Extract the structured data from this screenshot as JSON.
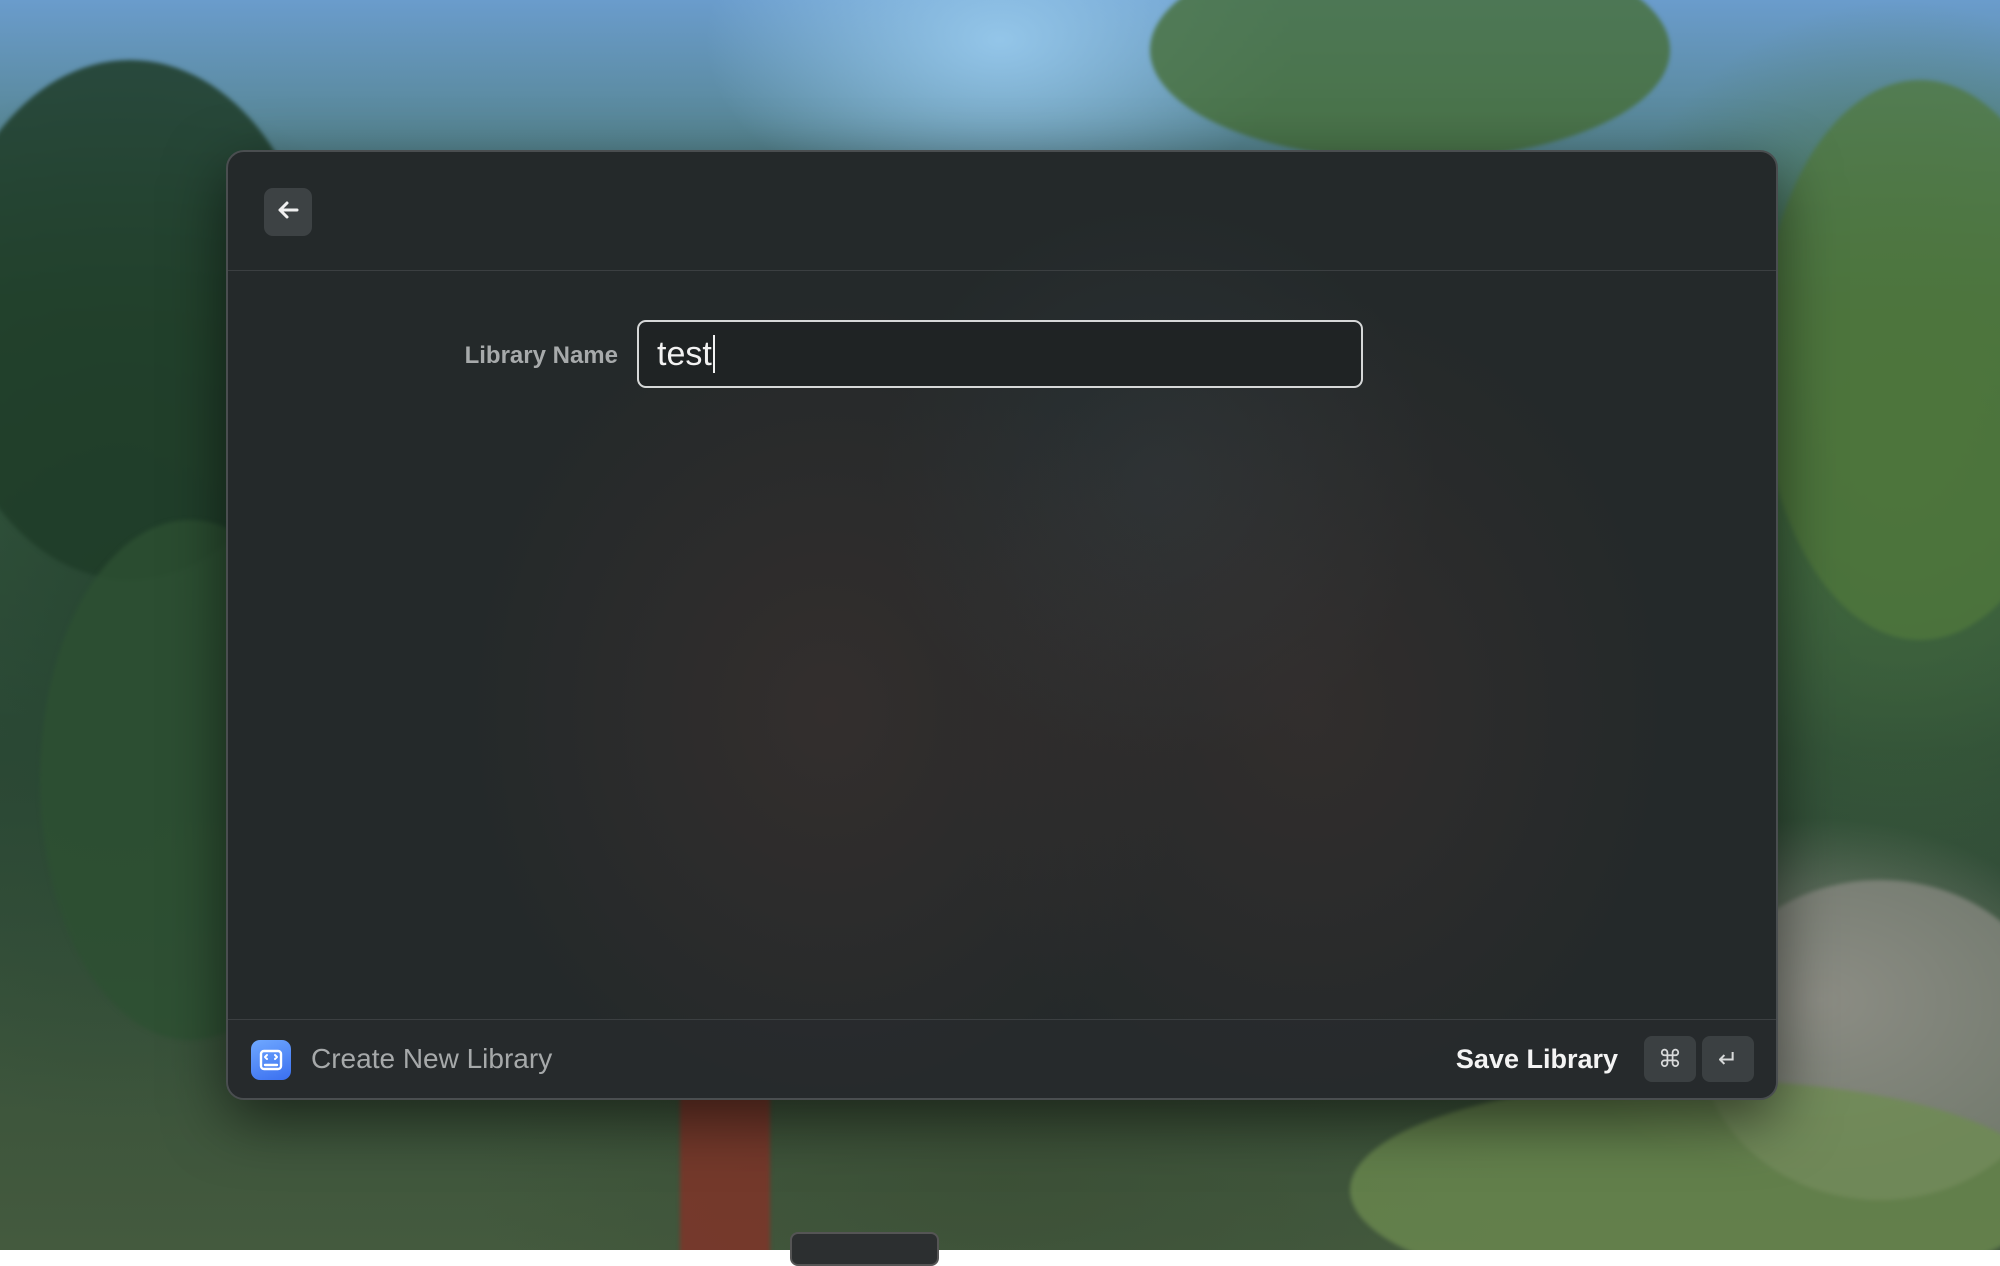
{
  "header": {
    "back_icon": "arrow-left-icon"
  },
  "form": {
    "label": "Library Name",
    "input_value": "test"
  },
  "footer": {
    "app_icon": "code-library-icon",
    "title": "Create New Library",
    "save_label": "Save Library",
    "shortcut_keys": [
      "⌘",
      "↵"
    ]
  },
  "colors": {
    "accent": "#3a6ff0",
    "window_bg": "#24292a"
  }
}
